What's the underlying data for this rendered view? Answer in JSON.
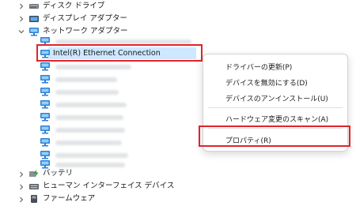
{
  "tree": {
    "top_items": [
      {
        "label": "ディスク ドライブ",
        "expanded": false,
        "icon": "disk-drive-icon"
      },
      {
        "label": "ディスプレイ アダプター",
        "expanded": false,
        "icon": "display-adapter-icon"
      },
      {
        "label": "ネットワーク アダプター",
        "expanded": true,
        "icon": "network-adapter-icon"
      }
    ],
    "network_children": [
      {
        "label": "",
        "blurred": true
      },
      {
        "label": "Intel(R) Ethernet Connection",
        "blurred": false,
        "selected": true
      },
      {
        "label": "",
        "blurred": true
      },
      {
        "label": "",
        "blurred": true
      },
      {
        "label": "",
        "blurred": true
      },
      {
        "label": "",
        "blurred": true
      },
      {
        "label": "",
        "blurred": true
      },
      {
        "label": "",
        "blurred": true
      },
      {
        "label": "",
        "blurred": true
      },
      {
        "label": "",
        "blurred": true
      },
      {
        "label": "",
        "blurred": true
      },
      {
        "label": "",
        "blurred": true
      },
      {
        "label": "",
        "blurred": true
      }
    ],
    "bottom_items": [
      {
        "label": "バッテリ",
        "expanded": false,
        "icon": "battery-icon"
      },
      {
        "label": "ヒューマン インターフェイス デバイス",
        "expanded": false,
        "icon": "hid-icon"
      },
      {
        "label": "ファームウェア",
        "expanded": false,
        "icon": "firmware-icon"
      }
    ]
  },
  "context_menu": {
    "items": [
      {
        "label": "ドライバーの更新(P)"
      },
      {
        "label": "デバイスを無効にする(D)"
      },
      {
        "label": "デバイスのアンインストール(U)"
      },
      {
        "separator": true
      },
      {
        "label": "ハードウェア変更のスキャン(A)"
      },
      {
        "separator": true
      },
      {
        "label": "プロパティ(R)",
        "highlighted": true
      }
    ]
  },
  "colors": {
    "selection": "#cde8ff",
    "highlight_box": "#e0242b",
    "network_icon": "#2f7fd4"
  }
}
